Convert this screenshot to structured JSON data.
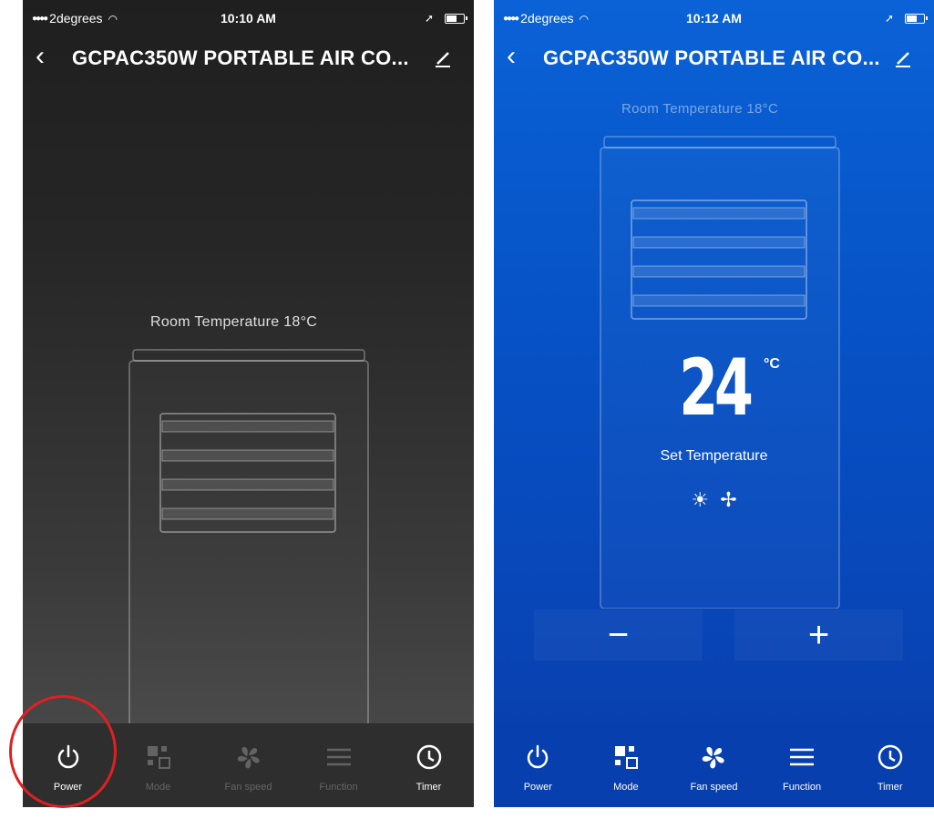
{
  "left": {
    "status": {
      "carrier": "2degrees",
      "time": "10:10 AM"
    },
    "title": "GCPAC350W PORTABLE AIR CO...",
    "room_temperature": "Room Temperature  18°C",
    "toolbar": [
      {
        "icon": "power-icon",
        "label": "Power",
        "enabled": true
      },
      {
        "icon": "mode-icon",
        "label": "Mode",
        "enabled": false
      },
      {
        "icon": "fan-icon",
        "label": "Fan speed",
        "enabled": false
      },
      {
        "icon": "function-icon",
        "label": "Function",
        "enabled": false
      },
      {
        "icon": "timer-icon",
        "label": "Timer",
        "enabled": true
      }
    ]
  },
  "right": {
    "status": {
      "carrier": "2degrees",
      "time": "10:12 AM"
    },
    "title": "GCPAC350W PORTABLE AIR CO...",
    "room_temperature": "Room Temperature  18°C",
    "set_temperature": "24",
    "set_temperature_unit": "°C",
    "set_temperature_label": "Set Temperature",
    "decrease_label": "−",
    "increase_label": "+",
    "toolbar": [
      {
        "icon": "power-icon",
        "label": "Power"
      },
      {
        "icon": "mode-icon",
        "label": "Mode"
      },
      {
        "icon": "fan-icon",
        "label": "Fan speed"
      },
      {
        "icon": "function-icon",
        "label": "Function"
      },
      {
        "icon": "timer-icon",
        "label": "Timer"
      }
    ]
  },
  "colors": {
    "left_bg": "#262626",
    "right_bg": "#0652c6",
    "highlight_ring": "#e02020"
  }
}
